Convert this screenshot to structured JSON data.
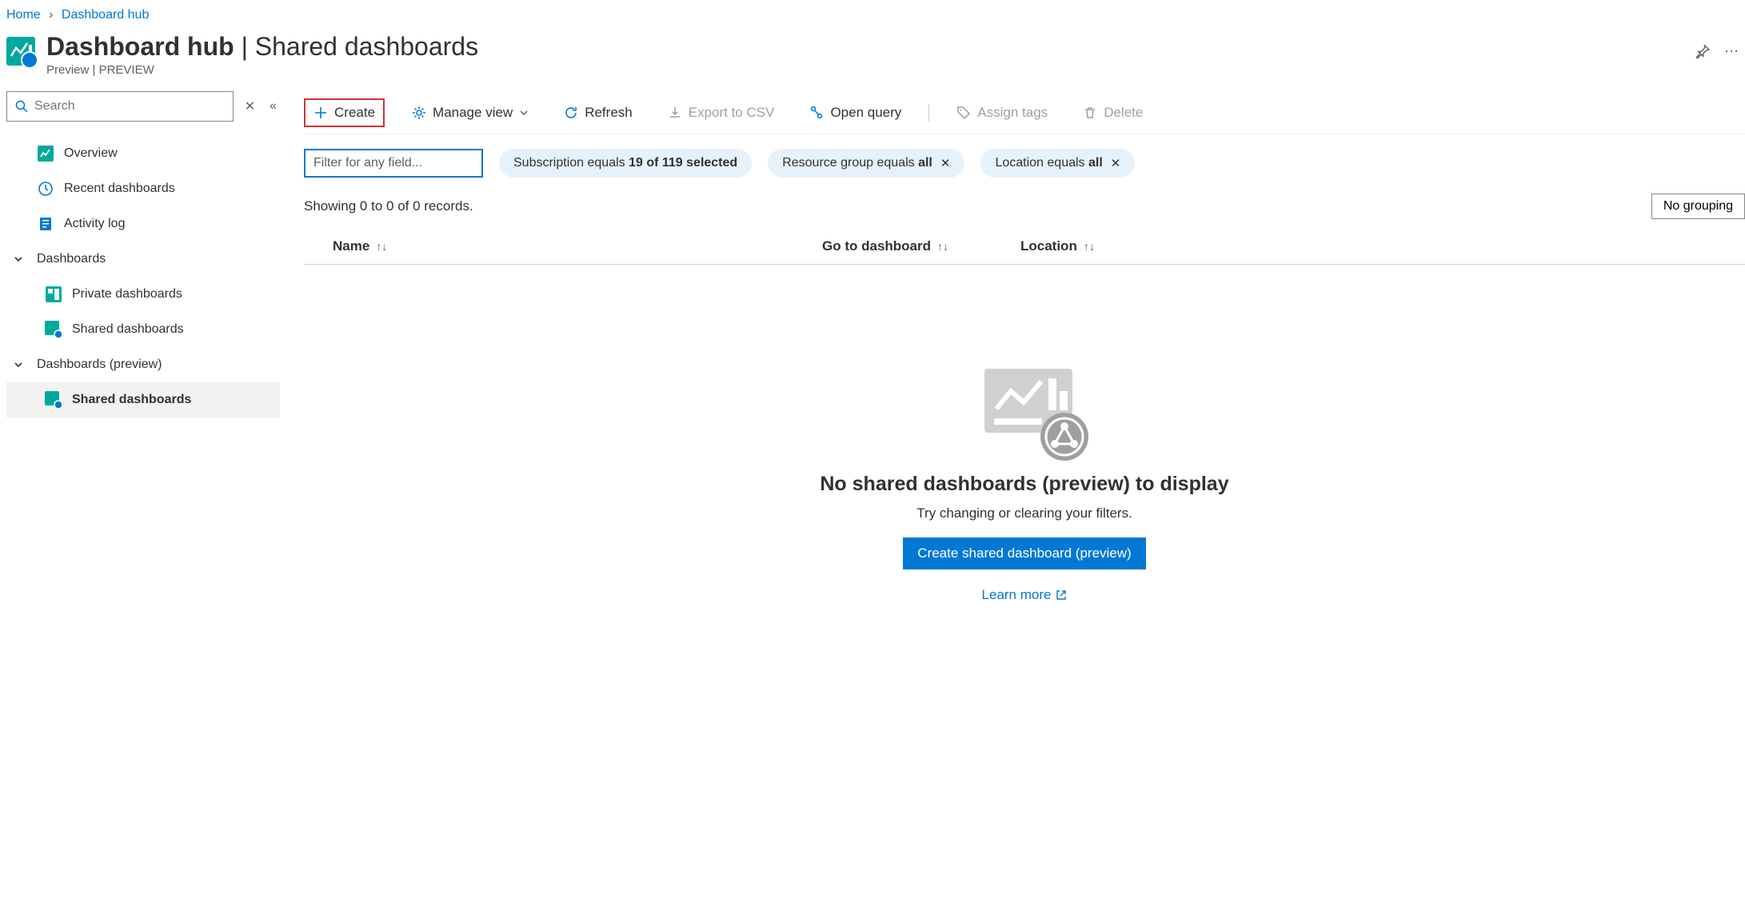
{
  "breadcrumb": {
    "home": "Home",
    "current": "Dashboard hub"
  },
  "header": {
    "title_main": "Dashboard hub",
    "title_sep": " | ",
    "title_sub": "Shared dashboards",
    "subtitle": "Preview | PREVIEW"
  },
  "sidebar": {
    "search_placeholder": "Search",
    "items": [
      {
        "label": "Overview",
        "icon": "chart-icon"
      },
      {
        "label": "Recent dashboards",
        "icon": "clock-icon"
      },
      {
        "label": "Activity log",
        "icon": "log-icon"
      },
      {
        "label": "Dashboards",
        "icon": "chevron",
        "group": true
      },
      {
        "label": "Private dashboards",
        "icon": "dashboard-icon",
        "indent": true
      },
      {
        "label": "Shared dashboards",
        "icon": "dashboard-shared-icon",
        "indent": true
      },
      {
        "label": "Dashboards (preview)",
        "icon": "chevron",
        "group": true
      },
      {
        "label": "Shared dashboards",
        "icon": "dashboard-shared-icon",
        "indent": true,
        "active": true
      }
    ]
  },
  "toolbar": {
    "create": "Create",
    "manage_view": "Manage view",
    "refresh": "Refresh",
    "export_csv": "Export to CSV",
    "open_query": "Open query",
    "assign_tags": "Assign tags",
    "delete": "Delete"
  },
  "filters": {
    "input_placeholder": "Filter for any field...",
    "subscription_prefix": "Subscription equals ",
    "subscription_value": "19 of 119 selected",
    "resource_group_prefix": "Resource group equals ",
    "resource_group_value": "all",
    "location_prefix": "Location equals ",
    "location_value": "all"
  },
  "status": {
    "records": "Showing 0 to 0 of 0 records.",
    "no_grouping": "No grouping"
  },
  "columns": {
    "name": "Name",
    "goto": "Go to dashboard",
    "location": "Location"
  },
  "empty": {
    "title": "No shared dashboards (preview) to display",
    "text": "Try changing or clearing your filters.",
    "button": "Create shared dashboard (preview)",
    "learn_more": "Learn more"
  }
}
